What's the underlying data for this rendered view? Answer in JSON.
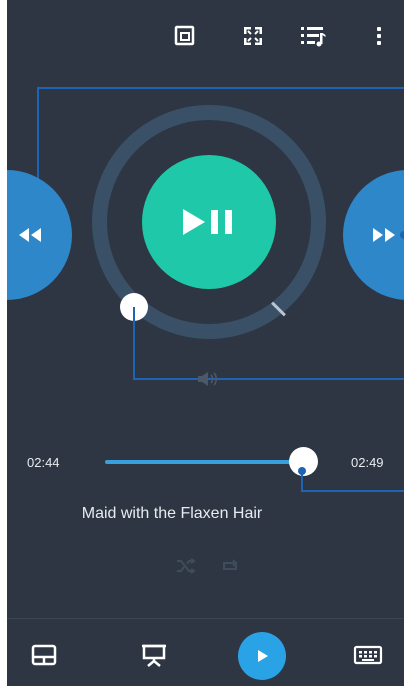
{
  "playback": {
    "elapsed": "02:44",
    "total": "02:49",
    "progress_fraction": 0.97
  },
  "track": {
    "title": "Maid with the Flaxen Hair"
  },
  "icons": {
    "top": [
      "cast-screen-icon",
      "fullscreen-icon",
      "playlist-icon",
      "more-vert-icon"
    ],
    "main": [
      "rewind-icon",
      "play-pause-icon",
      "fast-forward-icon",
      "volume-icon"
    ],
    "secondary": [
      "shuffle-icon",
      "repeat-icon"
    ],
    "bottom": [
      "touchpad-icon",
      "presentation-icon",
      "media-play-icon",
      "keyboard-icon"
    ]
  },
  "colors": {
    "background": "#2d3642",
    "accent_teal": "#1fc8a8",
    "accent_blue": "#2e87c8",
    "annotation": "#1e64b4"
  }
}
